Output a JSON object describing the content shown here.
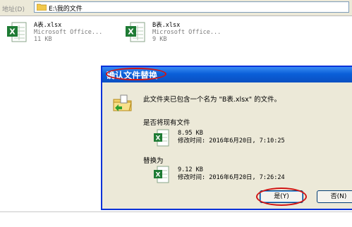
{
  "address_bar": {
    "label": "地址(D)",
    "path": "E:\\我的文件"
  },
  "files": [
    {
      "name": "A表.xlsx",
      "type": "Microsoft Office...",
      "size": "11 KB"
    },
    {
      "name": "B表.xlsx",
      "type": "Microsoft Office...",
      "size": "9 KB"
    }
  ],
  "dialog": {
    "title": "确认文件替换",
    "message": "此文件夹已包含一个名为 \"B表.xlsx\" 的文件。",
    "existing_label": "是否将现有文件",
    "existing_size": "8.95 KB",
    "existing_modified": "修改时间: 2016年6月20日, 7:10:25",
    "replace_label": "替换为",
    "new_size": "9.12 KB",
    "new_modified": "修改时间: 2016年6月20日, 7:26:24",
    "yes_button": "是(Y)",
    "no_button": "否(N)"
  },
  "colors": {
    "titlebar": "#0a5fd8",
    "highlight": "#d01515",
    "excel_green": "#1e7b34"
  }
}
